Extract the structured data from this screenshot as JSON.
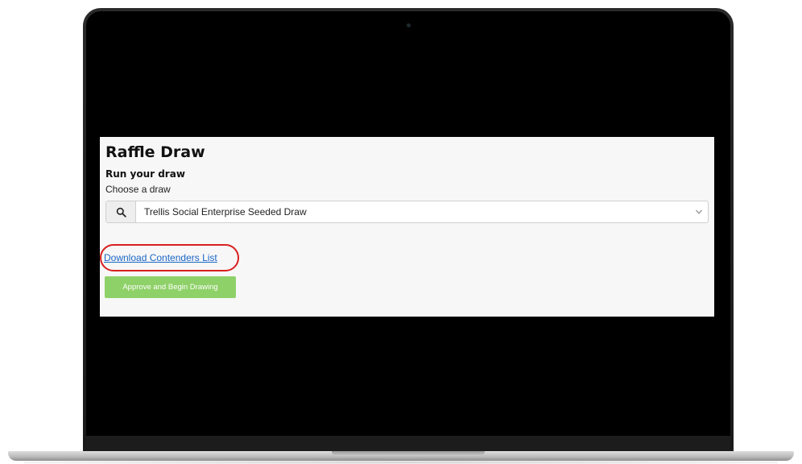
{
  "page": {
    "title": "Raffle Draw",
    "section_title": "Run your draw",
    "choose_label": "Choose a draw"
  },
  "draw_select": {
    "icon": "search-icon",
    "selected_value": "Trellis Social Enterprise Seeded Draw",
    "caret_icon": "chevron-down-icon"
  },
  "actions": {
    "download_link_label": "Download Contenders List",
    "approve_button_label": "Approve and Begin Drawing"
  },
  "colors": {
    "highlight_ring": "#d91f1f",
    "link": "#1a66c7",
    "approve_button": "#8fd169"
  }
}
